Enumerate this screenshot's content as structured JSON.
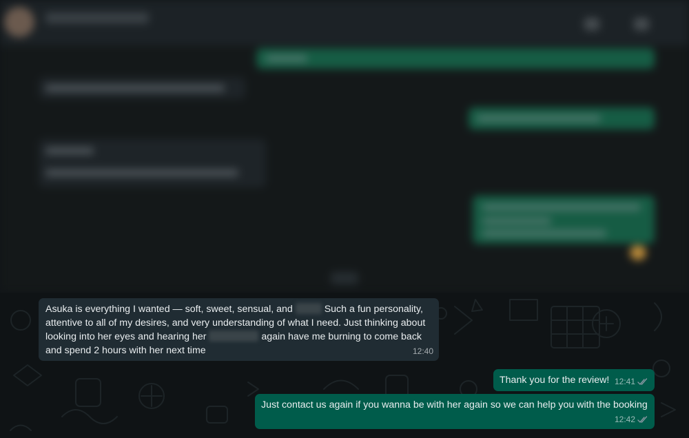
{
  "chat": {
    "messages": [
      {
        "direction": "incoming",
        "text_part1": "Asuka is everything I wanted — soft, sweet, sensual, and ",
        "text_part2": " Such a fun personality, attentive to all of my desires, and very understanding of what I need. Just thinking about looking into her eyes and hearing her ",
        "text_part3": " again have me burning to come back and spend 2 hours with her next time",
        "time": "12:40"
      },
      {
        "direction": "outgoing",
        "text": "Thank you for the review!",
        "time": "12:41",
        "status": "read"
      },
      {
        "direction": "outgoing",
        "text": "Just contact us again if you wanna be with her again so we can help you with the booking",
        "time": "12:42",
        "status": "read"
      }
    ]
  },
  "colors": {
    "incoming_bubble": "#202c33",
    "outgoing_bubble": "#005c4b",
    "read_ticks": "#8696a0"
  }
}
